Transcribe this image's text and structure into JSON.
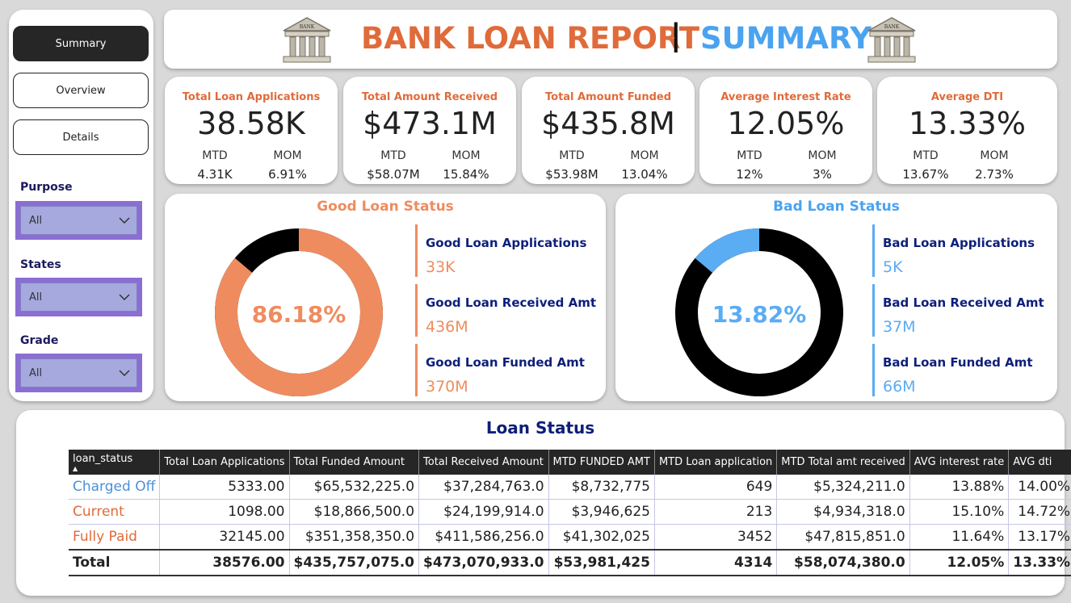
{
  "colors": {
    "good": "#ef8c5f",
    "bad": "#5aacf3",
    "dark": "#000000",
    "title_orange": "#e06b3a",
    "title_blue": "#4aa3f0"
  },
  "nav": {
    "items": [
      "Summary",
      "Overview",
      "Details"
    ],
    "active": "Summary"
  },
  "filters": [
    {
      "label": "Purpose",
      "value": "All"
    },
    {
      "label": "States",
      "value": "All"
    },
    {
      "label": "Grade",
      "value": "All"
    }
  ],
  "header": {
    "title_left": "BANK LOAN REPORT",
    "separator": "|",
    "title_right": "SUMMARY",
    "icon": "bank-icon",
    "icon_label": "BANK"
  },
  "kpis": [
    {
      "title": "Total Loan Applications",
      "value": "38.58K",
      "mtd_label": "MTD",
      "mom_label": "MOM",
      "mtd": "4.31K",
      "mom": "6.91%"
    },
    {
      "title": "Total Amount Received",
      "value": "$473.1M",
      "mtd_label": "MTD",
      "mom_label": "MOM",
      "mtd": "$58.07M",
      "mom": "15.84%"
    },
    {
      "title": "Total Amount Funded",
      "value": "$435.8M",
      "mtd_label": "MTD",
      "mom_label": "MOM",
      "mtd": "$53.98M",
      "mom": "13.04%"
    },
    {
      "title": "Average Interest Rate",
      "value": "12.05%",
      "mtd_label": "MTD",
      "mom_label": "MOM",
      "mtd": "12%",
      "mom": "3%"
    },
    {
      "title": "Average DTI",
      "value": "13.33%",
      "mtd_label": "MTD",
      "mom_label": "MOM",
      "mtd": "13.67%",
      "mom": "2.73%"
    }
  ],
  "good": {
    "title": "Good Loan Status",
    "percent_label": "86.18%",
    "percent": 86.18,
    "stats": [
      {
        "label": "Good Loan Applications",
        "value": "33K"
      },
      {
        "label": "Good Loan Received Amt",
        "value": "436M"
      },
      {
        "label": "Good Loan Funded Amt",
        "value": "370M"
      }
    ]
  },
  "bad": {
    "title": "Bad Loan Status",
    "percent_label": "13.82%",
    "percent": 13.82,
    "stats": [
      {
        "label": "Bad Loan Applications",
        "value": "5K"
      },
      {
        "label": "Bad Loan Received Amt",
        "value": "37M"
      },
      {
        "label": "Bad Loan Funded Amt",
        "value": "66M"
      }
    ]
  },
  "table": {
    "title": "Loan Status",
    "columns": [
      "loan_status",
      "Total Loan Applications",
      "Total Funded Amount",
      "Total Received Amount",
      "MTD FUNDED AMT",
      "MTD Loan application",
      "MTD Total amt received",
      "AVG interest rate",
      "AVG dti"
    ],
    "rows": [
      {
        "status": "Charged Off",
        "color": "#4a90d9",
        "cells": [
          "5333.00",
          "$65,532,225.0",
          "$37,284,763.0",
          "$8,732,775",
          "649",
          "$5,324,211.0",
          "13.88%",
          "14.00%"
        ]
      },
      {
        "status": "Current",
        "color": "#e06b3a",
        "cells": [
          "1098.00",
          "$18,866,500.0",
          "$24,199,914.0",
          "$3,946,625",
          "213",
          "$4,934,318.0",
          "15.10%",
          "14.72%"
        ]
      },
      {
        "status": "Fully Paid",
        "color": "#e06b3a",
        "cells": [
          "32145.00",
          "$351,358,350.0",
          "$411,586,256.0",
          "$41,302,025",
          "3452",
          "$47,815,851.0",
          "11.64%",
          "13.17%"
        ]
      }
    ],
    "total": {
      "status": "Total",
      "cells": [
        "38576.00",
        "$435,757,075.0",
        "$473,070,933.0",
        "$53,981,425",
        "4314",
        "$58,074,380.0",
        "12.05%",
        "13.33%"
      ]
    }
  }
}
